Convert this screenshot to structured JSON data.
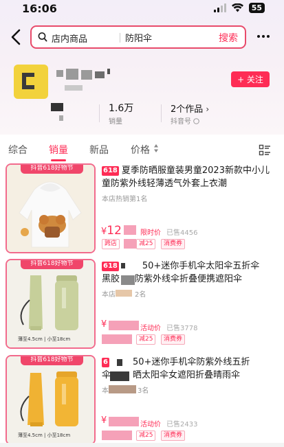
{
  "status_bar": {
    "time": "16:06",
    "battery": "55"
  },
  "search": {
    "scope": "店内商品",
    "query": "防阳伞",
    "button": "搜索"
  },
  "shop": {
    "follow_label": "+ 关注",
    "stats": [
      {
        "value": "1.6万",
        "label": "销量"
      },
      {
        "value": "2个作品",
        "label": "抖音号"
      }
    ]
  },
  "tabs": [
    "综合",
    "销量",
    "新品",
    "价格"
  ],
  "products": [
    {
      "badge": "618",
      "title": "夏季防晒服童装男童2023新款中小儿童防紫外线轻薄透气外套上衣潮",
      "rank": "本店热销第1名",
      "price_symbol": "¥",
      "price_visible": "12",
      "limit_label": "限时价",
      "sold": "已售4456",
      "chips": [
        "跨店",
        "减25",
        "消费券"
      ],
      "promo_banner": "抖音618好物节"
    },
    {
      "badge": "618",
      "title": "50+迷你手机伞太阳伞五折伞",
      "title_line2": "防紫外线伞折叠便携遮阳伞",
      "title_line2_prefix": "黑胶",
      "rank_prefix": "本店",
      "rank_suffix": "2名",
      "price_symbol": "¥",
      "limit_label": "活动价",
      "sold": "已售3778",
      "chips": [
        "减25",
        "消费券"
      ],
      "promo_banner": "抖音618好物节",
      "size_label": "薄至4.5cm | 小至18cm"
    },
    {
      "badge": "6",
      "title": "50+迷你手机伞防紫外线五折",
      "title_line2": "晒太阳伞女遮阳折叠晴雨伞",
      "title_line2_prefix": "伞",
      "rank_suffix": "3名",
      "rank_prefix": "本",
      "price_symbol": "¥",
      "limit_label": "活动价",
      "sold": "已售2433",
      "chips": [
        "减25",
        "消费券"
      ],
      "promo_banner": "抖音618好物节",
      "size_label": "薄至4.5cm | 小至18cm"
    }
  ],
  "colors": {
    "accent": "#fe2c55",
    "umbrella_green": "#c6cf9a",
    "umbrella_yellow": "#f0b233"
  }
}
